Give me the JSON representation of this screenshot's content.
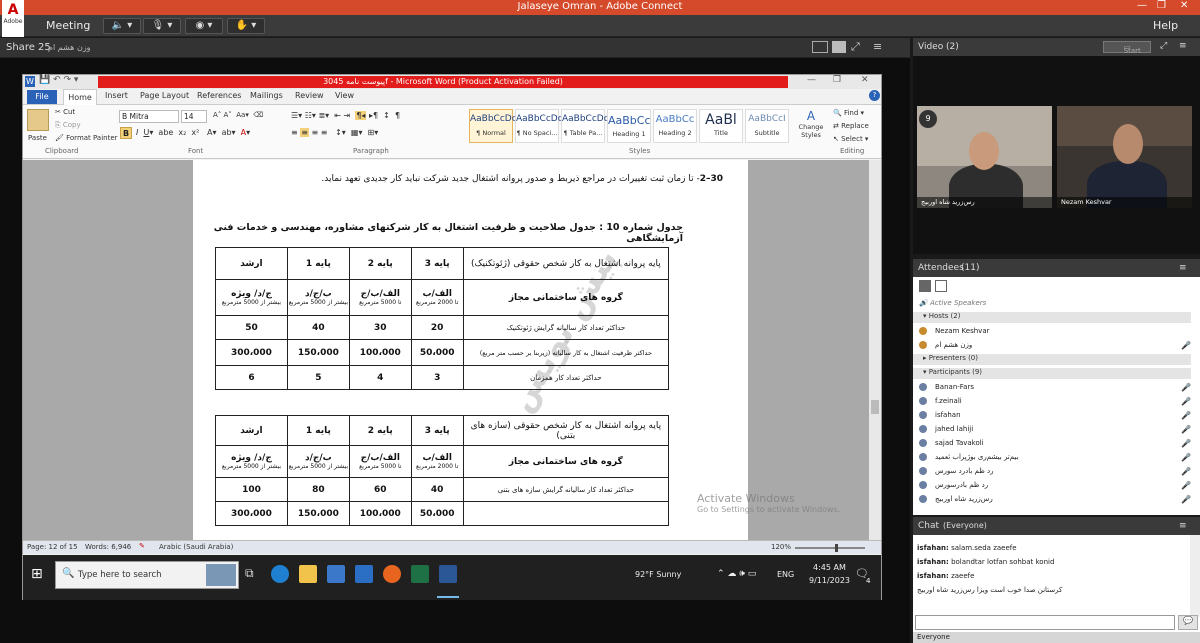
{
  "app": {
    "title": "Jalaseye Omran - Adobe Connect",
    "logo_text": "Adobe",
    "menu": {
      "meeting": "Meeting",
      "help": "Help"
    }
  },
  "share_pod": {
    "label": "Share 25",
    "presenter_name": "وزن هشم ام",
    "word": {
      "title": "پیوست نامه 3045f - Microsoft Word (Product Activation Failed)",
      "tabs": [
        "File",
        "Home",
        "Insert",
        "Page Layout",
        "References",
        "Mailings",
        "Review",
        "View"
      ],
      "ribbon": {
        "font_name": "B Mitra",
        "font_size": "14",
        "paste_label": "Paste",
        "cut_label": "Cut",
        "copy_label": "Copy",
        "format_painter_label": "Format Painter",
        "groups": [
          "Clipboard",
          "Font",
          "Paragraph",
          "Styles",
          "Editing"
        ],
        "styles": [
          {
            "preview": "AaBbCcDc",
            "name": "¶ Normal"
          },
          {
            "preview": "AaBbCcDc",
            "name": "¶ No Spaci..."
          },
          {
            "preview": "AaBbCcDc",
            "name": "¶ Table Pa..."
          },
          {
            "preview": "AaBbCc",
            "name": "Heading 1"
          },
          {
            "preview": "AaBbCc",
            "name": "Heading 2"
          },
          {
            "preview": "AaBl",
            "name": "Title"
          },
          {
            "preview": "AaBbCcI",
            "name": "Subtitle"
          }
        ],
        "change_styles": "Change Styles",
        "find": "Find",
        "replace": "Replace",
        "select": "Select"
      },
      "document": {
        "clause_number": "30–2",
        "clause_text": "- تا زمان ثبت تغییرات در مراجع ذیربط و صدور پروانه اشتغال جدید شرکت نباید کار جدیدی تعهد نماید.",
        "table_title": "جدول شماره 10 : جدول صلاحیت و ظرفیت اشتغال به کار شرکتهای مشاوره، مهندسی و خدمات فنی آزمایشگاهی",
        "table1": {
          "corner": "پایه پروانه اشتغال به کار شخص حقوقی (ژئوتکنیک)",
          "grades": [
            "پایه 3",
            "پایه 2",
            "پایه 1",
            "ارشد"
          ],
          "group_label": "گروه های ساختمانی مجاز",
          "groups": [
            "الف/ب",
            "الف/ب/ج",
            "ب/ج/د",
            "ج/د/ ویژه"
          ],
          "group_notes": [
            "تا 2000 مترمربع",
            "تا 5000 مترمربع",
            "بیشتر از 5000 مترمربع",
            "بیشتر از 5000 مترمربع"
          ],
          "rows": [
            {
              "label": "حداکثر تعداد کار سالیانه گرایش ژئوتکنیک",
              "values": [
                "20",
                "30",
                "40",
                "50"
              ]
            },
            {
              "label": "حداکثر ظرفیت اشتغال به کار سالیانه (زیربنا بر حسب متر مربع)",
              "values": [
                "50،000",
                "100،000",
                "150،000",
                "300،000"
              ]
            },
            {
              "label": "حداکثر تعداد کار همزمان",
              "values": [
                "3",
                "4",
                "5",
                "6"
              ]
            }
          ]
        },
        "table2": {
          "corner": "پایه پروانه اشتغال به کار شخص حقوقی (سازه های بتنی)",
          "grades": [
            "پایه 3",
            "پایه 2",
            "پایه 1",
            "ارشد"
          ],
          "group_label": "گروه های ساختمانی مجاز",
          "groups": [
            "الف/ب",
            "الف/ب/ج",
            "ب/ج/د",
            "ج/د/ ویژه"
          ],
          "group_notes": [
            "تا 2000 مترمربع",
            "تا 5000 مترمربع",
            "بیشتر از 5000 مترمربع",
            "بیشتر از 5000 مترمربع"
          ],
          "rows": [
            {
              "label": "حداکثر تعداد کار سالیانه گرایش سازه های بتنی",
              "values": [
                "40",
                "60",
                "80",
                "100"
              ]
            },
            {
              "label": "",
              "values": [
                "50،000",
                "100،000",
                "150،000",
                "300،000"
              ]
            }
          ]
        },
        "activate": {
          "title": "Activate Windows",
          "sub": "Go to Settings to activate Windows."
        }
      },
      "status": {
        "page": "Page: 12 of 15",
        "words": "Words: 6,946",
        "language": "Arabic (Saudi Arabia)",
        "zoom": "120%"
      }
    },
    "taskbar": {
      "search_placeholder": "Type here to search",
      "weather": "92°F  Sunny",
      "lang": "ENG",
      "time": "4:45 AM",
      "date": "9/11/2023",
      "notif_count": "4"
    }
  },
  "video_pod": {
    "title": "Video",
    "count": "(2)",
    "start_label": "Start",
    "feeds": [
      {
        "name": "رس‌زرید شاه اوربیج"
      },
      {
        "name": "Nezam Keshvar"
      }
    ]
  },
  "attendees_pod": {
    "title": "Attendees",
    "count": "(11)",
    "active_speakers": "Active Speakers",
    "hosts_label": "Hosts (2)",
    "hosts": [
      "Nezam Keshvar",
      "وزن هشم ام"
    ],
    "presenters_label": "Presenters (0)",
    "participants_label": "Participants (9)",
    "participants": [
      "Banan-Fars",
      "f.zeinali",
      "isfahan",
      "jahed lahiji",
      "sajad Tavakoli",
      "بیم‌تر بیشم‌ری بوژپراب ثعمید",
      "رد ظم بادرد سورس",
      "رد ظم بادرسورس",
      "رس‌زرید شاه اوربیج"
    ]
  },
  "chat_pod": {
    "title": "Chat",
    "scope": "(Everyone)",
    "messages": [
      {
        "who": "isfahan:",
        "text": "salam.seda zaeefe"
      },
      {
        "who": "isfahan:",
        "text": "bolandtar lotfan sohbat konid"
      },
      {
        "who": "isfahan:",
        "text": "zaeefe"
      },
      {
        "who": "",
        "text": "کرستانن صدا خوب است ويزا رس‌زرید شاه اوربیج"
      }
    ],
    "recipient": "Everyone"
  },
  "colors": {
    "adobe_red": "#d44a2a",
    "word_blue": "#2a62b8",
    "activation_red": "#e21b1b"
  }
}
